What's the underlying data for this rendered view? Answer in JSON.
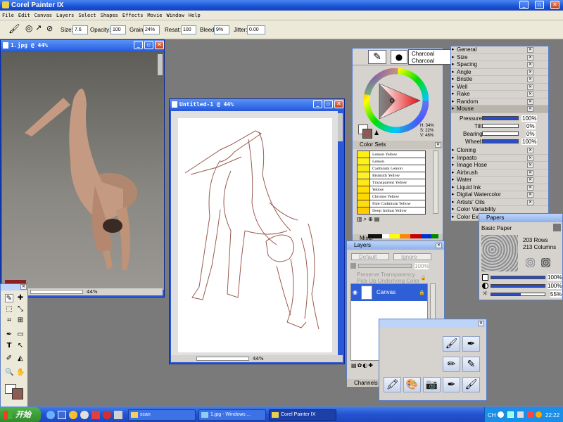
{
  "app": {
    "title": "Corel Painter IX"
  },
  "menu": [
    "File",
    "Edit",
    "Canvas",
    "Layers",
    "Select",
    "Shapes",
    "Effects",
    "Movie",
    "Window",
    "Help"
  ],
  "propbar": {
    "size_label": "Size:",
    "size": "7.6",
    "opacity_label": "Opacity:",
    "opacity": "100",
    "grain_label": "Grain:",
    "grain": "24%",
    "resat_label": "Resat:",
    "resat": "100",
    "bleed_label": "Bleed:",
    "bleed": "9%",
    "jitter_label": "Jitter:",
    "jitter": "0.00"
  },
  "doc1": {
    "title": "1.jpg @ 44%",
    "zoom": "44%"
  },
  "doc2": {
    "title": "Untitled-1 @ 44%",
    "zoom": "44%"
  },
  "brush_selector": {
    "category": "Charcoal",
    "variant": "Charcoal"
  },
  "colors": {
    "hsv_h": "H: 34%",
    "hsv_s": "S: 22%",
    "hsv_v": "V: 46%",
    "main_color": "#8c5c54",
    "sets_title": "Color Sets",
    "mixer_title": "Mixer",
    "swatches": [
      "Lemon Yellow",
      "Lemon",
      "Cadmium Lemon",
      "Bismuth Yellow",
      "Transparent Yellow",
      "Yellow",
      "Chrome Yellow",
      "Pale Cadmium Yellow",
      "Deep Indian Yellow"
    ]
  },
  "brush_controls": {
    "items_top": [
      "General",
      "Size",
      "Spacing",
      "Angle",
      "Bristle",
      "Well",
      "Rake",
      "Random"
    ],
    "mouse": "Mouse",
    "pressure_label": "Pressure:",
    "pressure": "100%",
    "tilt_label": "Tilt:",
    "tilt": "0%",
    "bearing_label": "Bearing:",
    "bearing": "0%",
    "wheel_label": "Wheel:",
    "wheel": "100%",
    "items_bottom": [
      "Cloning",
      "Impasto",
      "Image Hose",
      "Airbrush",
      "Water",
      "Liquid Ink",
      "Digital Watercolor",
      "Artists' Oils",
      "Color Variability",
      "Color Expression"
    ]
  },
  "papers": {
    "title": "Papers",
    "name": "Basic Paper",
    "rows": "203 Rows",
    "cols": "213 Columns",
    "v1": "100%",
    "v2": "100%",
    "v3": "55%"
  },
  "layers": {
    "title": "Layers",
    "composite": "Default",
    "method": "Ignore",
    "opacity": "100%",
    "preserve": "Preserve Transparency",
    "pickup": "Pick Up Underlying Color",
    "layer": "Canvas",
    "channels": "Channels"
  },
  "taskbar": {
    "start": "开始",
    "t1": "scan",
    "t2": "1.jpg - Windows ...",
    "t3": "Corel Painter IX",
    "lang": "CH",
    "time": "22:22"
  }
}
